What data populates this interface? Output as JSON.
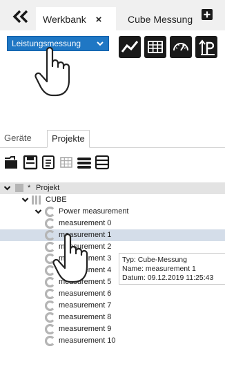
{
  "toolbar": {
    "tabs": [
      {
        "label": "Werkbank",
        "close": "×"
      },
      {
        "label": "Cube Messung"
      }
    ],
    "mode_select": {
      "value": "Leistungsmessung"
    },
    "icons": [
      "double-chevron-left-icon",
      "plus-icon",
      "trend-chart-icon",
      "table-icon",
      "gauge-icon",
      "export-icon"
    ]
  },
  "sidebar": {
    "tabs": [
      {
        "label": "Geräte"
      },
      {
        "label": "Projekte"
      }
    ],
    "tool_icons": [
      "open-folder-icon",
      "save-icon",
      "document-icon",
      "grid-icon",
      "layers-icon",
      "list-icon"
    ]
  },
  "tree": {
    "root": {
      "marker": "*",
      "label": "Projekt"
    },
    "cube": {
      "label": "CUBE"
    },
    "group": {
      "label": "Power measurement"
    },
    "items": [
      "measurement 0",
      "measurement 1",
      "measurement 2",
      "measurement 3",
      "measurement 4",
      "measurement 5",
      "measurement 6",
      "measurement 7",
      "measurement 8",
      "measurement 9",
      "measurement 10"
    ]
  },
  "tooltip": {
    "type_line": "Typ: Cube-Messung",
    "name_line": "Name: measurement 1",
    "date_line": "Datum: 09.12.2019 11:25:43"
  },
  "colors": {
    "accent_blue": "#1f77c4",
    "selection": "#d4dde9",
    "tree_icon": "#b8b8b8"
  }
}
